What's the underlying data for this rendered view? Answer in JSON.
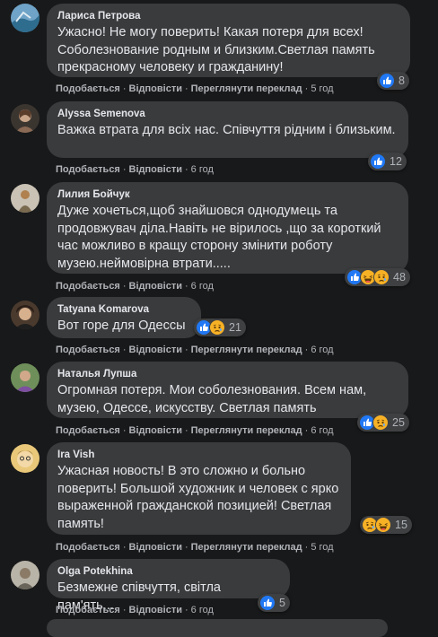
{
  "colors": {
    "bubble": "#3a3b3c",
    "background": "#18191a",
    "like": "#2078f4",
    "haha": "#f7b125"
  },
  "comments": [
    {
      "author": "Лариса Петрова",
      "text": "Ужасно! Не могу поверить! Какая потеря для всех! Соболезнование родным и близким.Светлая память прекрасному человеку и гражданину!",
      "like": "Подобається",
      "reply": "Відповісти",
      "translate": "Переглянути переклад",
      "time": "5 год",
      "reactions": [
        "like-icon"
      ],
      "count": "8"
    },
    {
      "author": "Alyssa Semenova",
      "text": "Важка втрата для всіх нас. Співчуття рідним і близьким.",
      "like": "Подобається",
      "reply": "Відповісти",
      "time": "6 год",
      "reactions": [
        "like-icon"
      ],
      "count": "12"
    },
    {
      "author": "Лилия Бойчук",
      "text": "Дуже хочеться,щоб знайшовся однодумець та продовжувач діла.Навіть не вірилось ,що за короткий час можливо в кращу сторону змінити роботу музею.неймовірна втрати.....",
      "like": "Подобається",
      "reply": "Відповісти",
      "time": "6 год",
      "reactions": [
        "like-icon",
        "haha-icon",
        "sad-icon"
      ],
      "count": "48"
    },
    {
      "author": "Tatyana Komarova",
      "text": "Вот горе для Одессы .",
      "like": "Подобається",
      "reply": "Відповісти",
      "translate": "Переглянути переклад",
      "time": "6 год",
      "reactions": [
        "like-icon",
        "sad-icon"
      ],
      "count": "21"
    },
    {
      "author": "Наталья Лупша",
      "text": "Огромная потеря. Мои соболезнования. Всем нам, музею, Одессе, искусству. Светлая память",
      "like": "Подобається",
      "reply": "Відповісти",
      "translate": "Переглянути переклад",
      "time": "6 год",
      "reactions": [
        "like-icon",
        "sad-icon"
      ],
      "count": "25"
    },
    {
      "author": "Ira Vish",
      "text": "Ужасная новость! В это сложно и больно поверить! Большой художник и человек с ярко выраженной гражданской позицией! Светлая память!",
      "like": "Подобається",
      "reply": "Відповісти",
      "translate": "Переглянути переклад",
      "time": "5 год",
      "reactions": [
        "sad-icon",
        "haha-icon"
      ],
      "count": "15"
    },
    {
      "author": "Olga Potekhina",
      "text": "Безмежне співчуття, світла пам'ять...",
      "like": "Подобається",
      "reply": "Відповісти",
      "time": "6 год",
      "reactions": [
        "like-icon"
      ],
      "count": "5"
    }
  ]
}
